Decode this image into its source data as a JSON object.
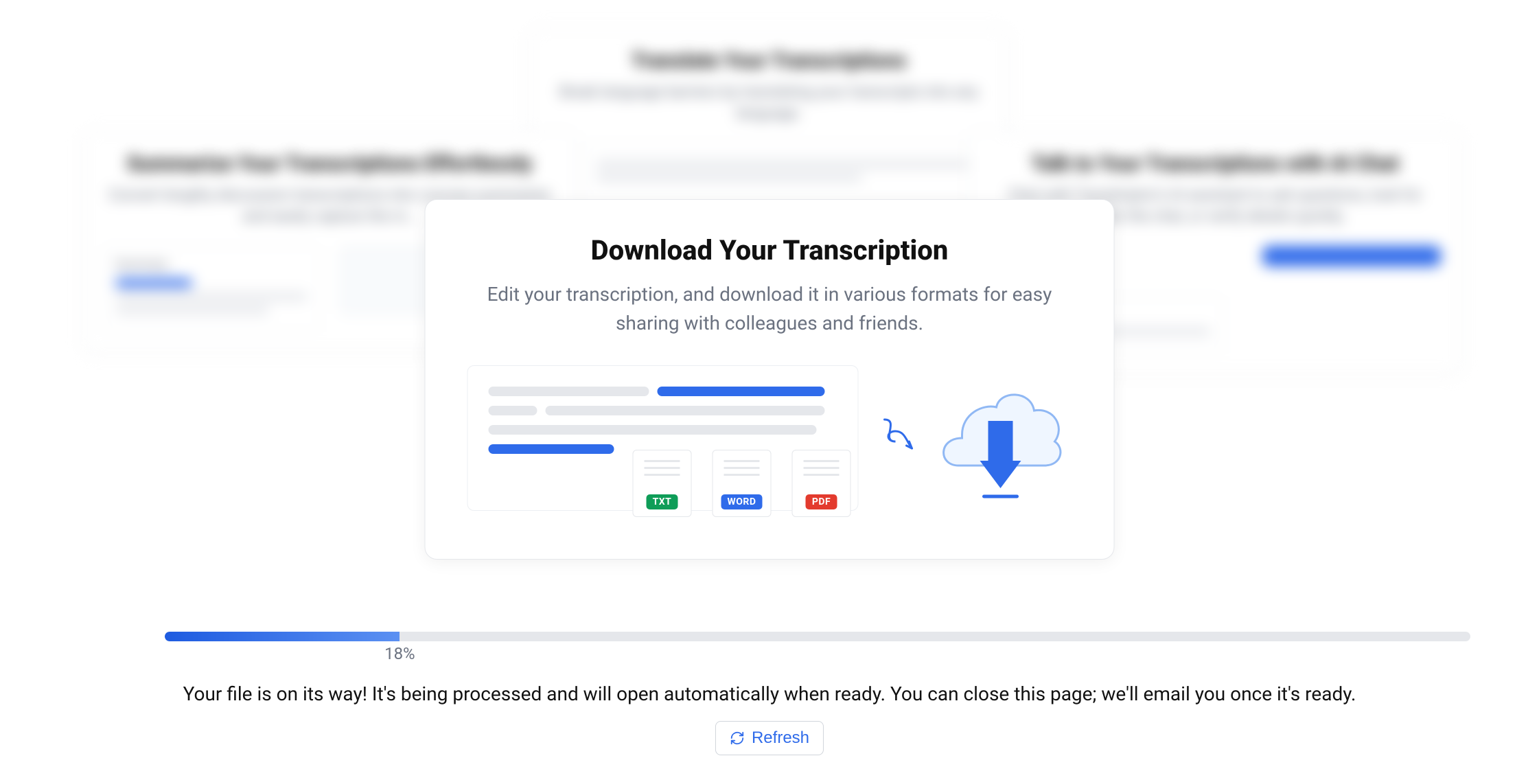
{
  "bg_cards": {
    "top": {
      "title": "Translate Your Transcriptions",
      "subtitle": "Break language barriers by translating your transcripts into any language."
    },
    "left": {
      "title": "Summarize Your Transcriptions Effortlessly",
      "subtitle": "Convert lengthy discussion transcriptions into concise summaries and easily capture the m…",
      "box_label": "Summary"
    },
    "right": {
      "title": "Talk to Your Transcriptions with AI Chat",
      "subtitle": "Chat with Transkriptor's AI assistant to ask questions, look for within the chat, or verify details quickly."
    }
  },
  "main_card": {
    "title": "Download Your Transcription",
    "description": "Edit your transcription, and download it in various formats for easy sharing with colleagues and friends.",
    "formats": {
      "txt": "TXT",
      "word": "WORD",
      "pdf": "PDF"
    }
  },
  "progress": {
    "percent": 18,
    "percent_label": "18%"
  },
  "status": {
    "message": "Your file is on its way! It's being processed and will open automatically when ready. You can close this page; we'll email you once it's ready."
  },
  "refresh": {
    "label": "Refresh"
  }
}
